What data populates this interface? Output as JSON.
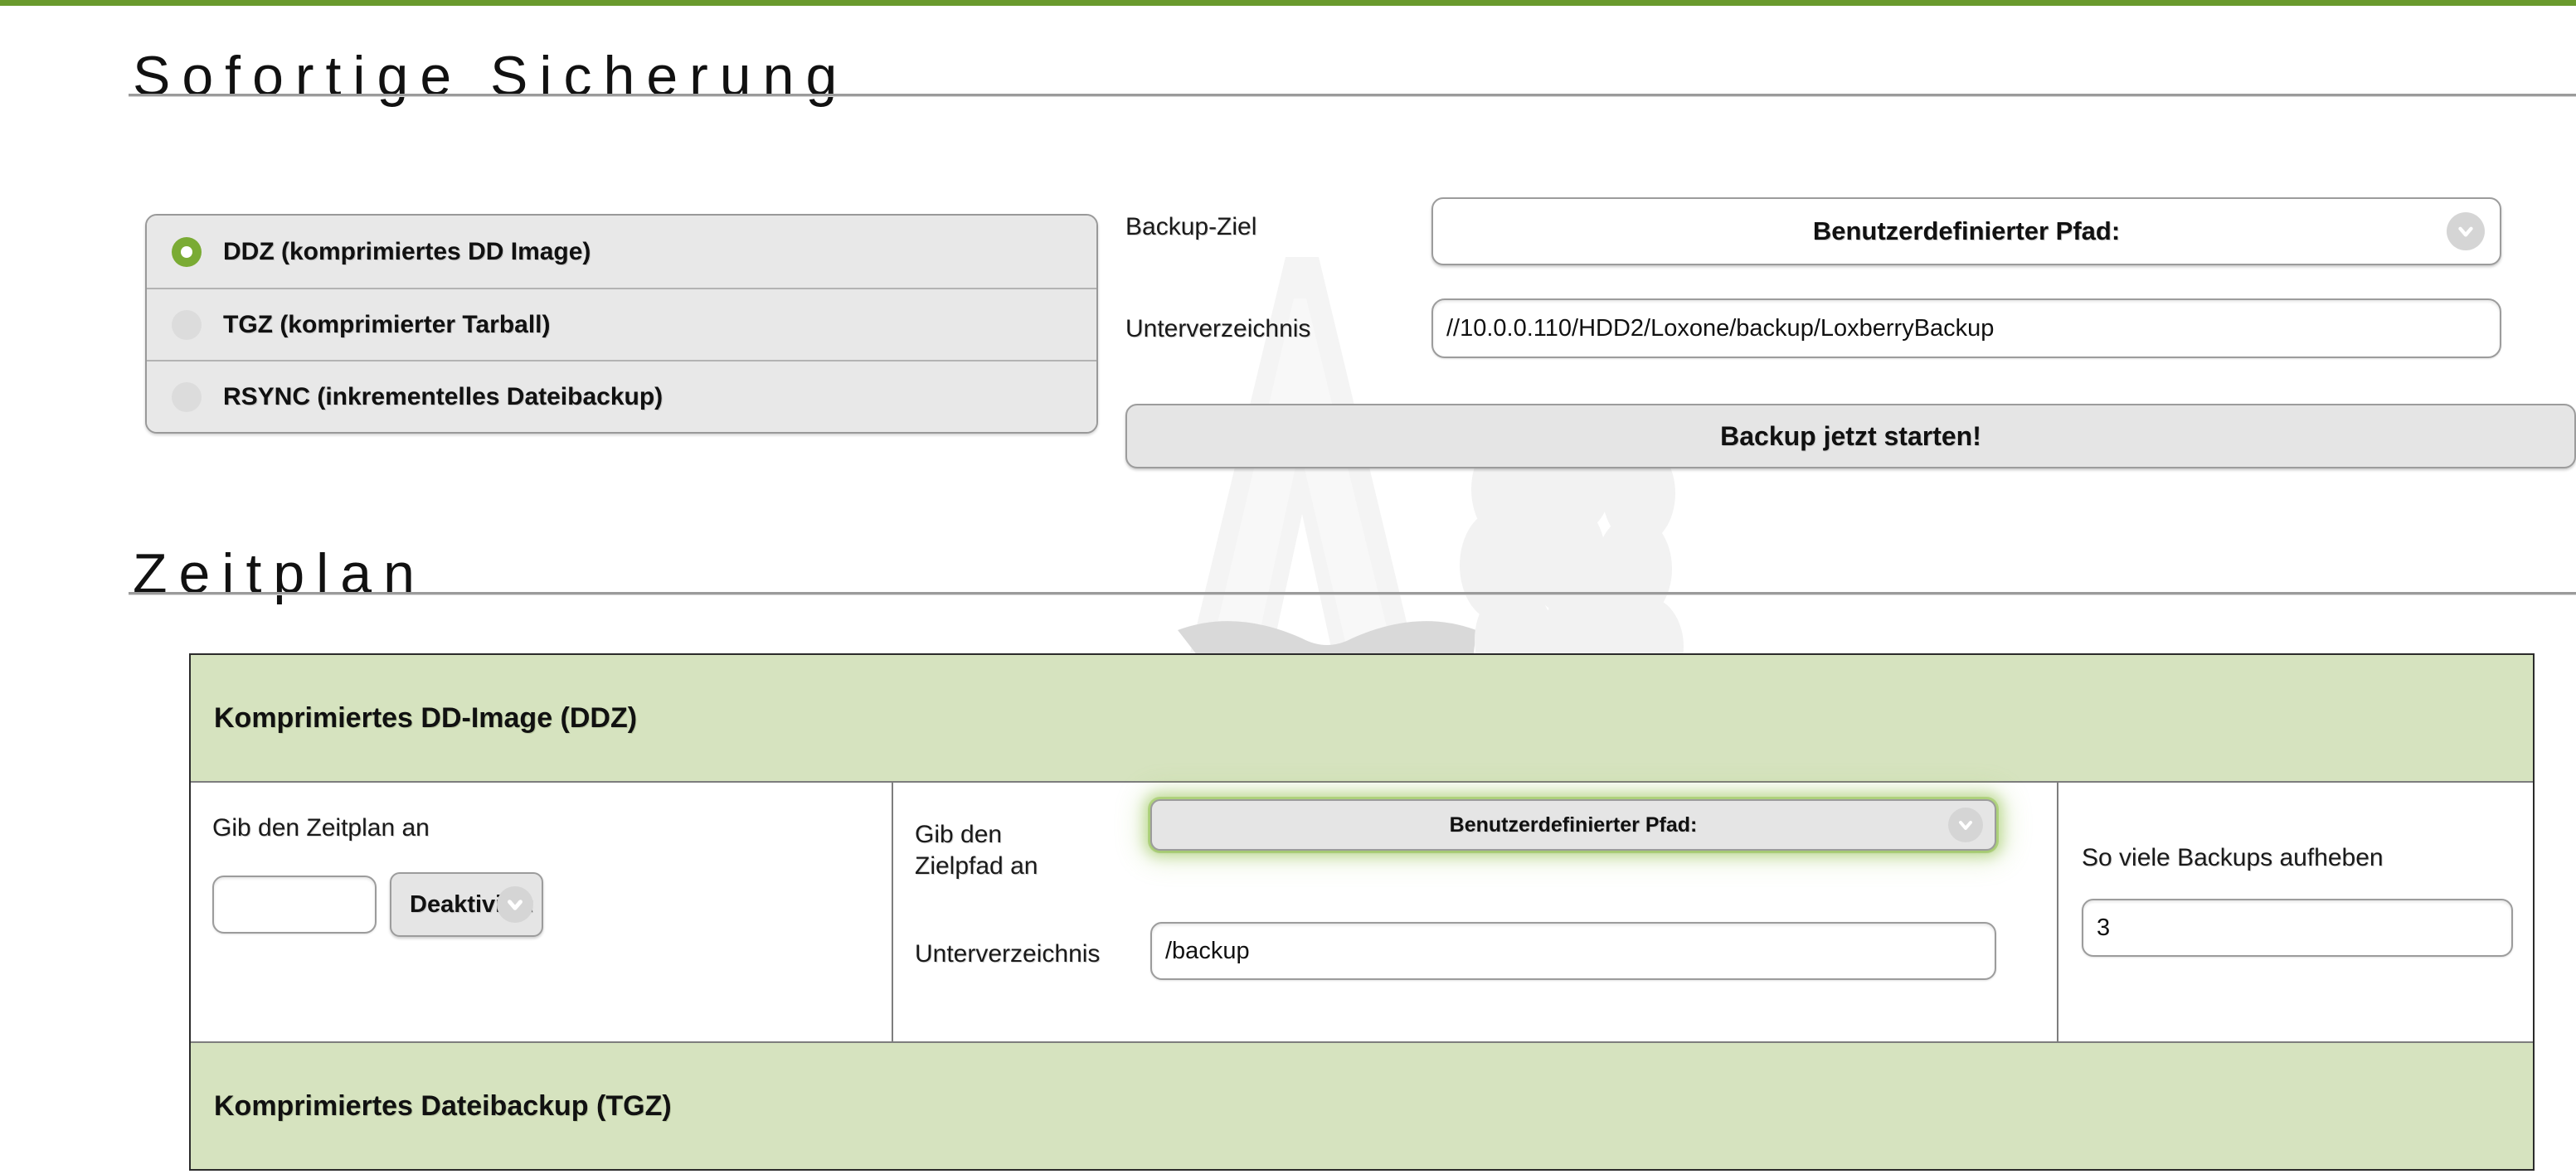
{
  "theme": {
    "accent_green": "#6a9a2d",
    "panel_green": "#d6e3bf",
    "radio_selected_green": "#7aab34",
    "control_gray": "#e5e5e5",
    "border_gray": "#9c9c9c"
  },
  "sections": {
    "immediate": {
      "heading": "Sofortige Sicherung",
      "backup_types": [
        {
          "label": "DDZ (komprimiertes DD Image)",
          "selected": true
        },
        {
          "label": "TGZ (komprimierter Tarball)",
          "selected": false
        },
        {
          "label": "RSYNC (inkrementelles Dateibackup)",
          "selected": false
        }
      ],
      "target_label": "Backup-Ziel",
      "target_value": "Benutzerdefinierter Pfad:",
      "subdir_label": "Unterverzeichnis",
      "subdir_value": "//10.0.0.110/HDD2/Loxone/backup/LoxberryBackup",
      "start_button": "Backup jetzt starten!"
    },
    "schedule": {
      "heading": "Zeitplan",
      "panels": [
        {
          "title": "Komprimiertes DD-Image (DDZ)",
          "schedule_label": "Gib den Zeitplan an",
          "schedule_value": "",
          "schedule_mode": "Deaktiviert",
          "targetpath_label": "Gib den Zielpfad an",
          "targetpath_value": "Benutzerdefinierter Pfad:",
          "subdir_label": "Unterverzeichnis",
          "subdir_value": "/backup",
          "keep_label": "So viele Backups aufheben",
          "keep_value": "3"
        },
        {
          "title": "Komprimiertes Dateibackup (TGZ)"
        }
      ]
    }
  },
  "icons": {
    "chevron_down": "chevron-down-icon",
    "watermark": "loxberry-logo-watermark"
  }
}
